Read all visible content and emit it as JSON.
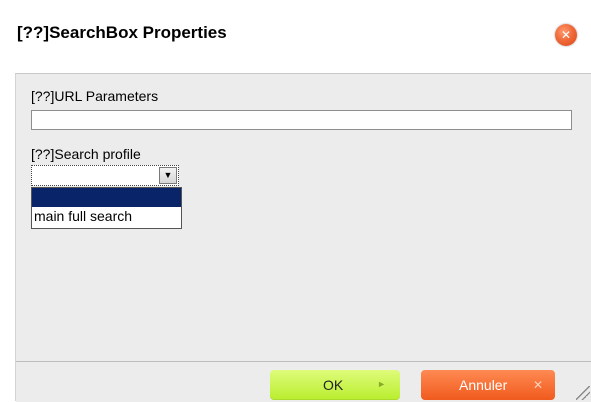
{
  "dialog": {
    "title": "[??]SearchBox Properties",
    "close_glyph": "✕"
  },
  "fields": {
    "url_parameters": {
      "label": "[??]URL Parameters",
      "value": ""
    },
    "search_profile": {
      "label": "[??]Search profile",
      "selected": "",
      "arrow_glyph": "▼",
      "options": [
        "",
        "main full search"
      ]
    }
  },
  "buttons": {
    "ok": {
      "label": "OK",
      "glyph": "►"
    },
    "cancel": {
      "label": "Annuler",
      "glyph": "✕"
    }
  },
  "colors": {
    "ok_button": "#b9ee2e",
    "cancel_button": "#f05a1e",
    "selected_option": "#0a246a",
    "close_button": "#f06a3a"
  }
}
